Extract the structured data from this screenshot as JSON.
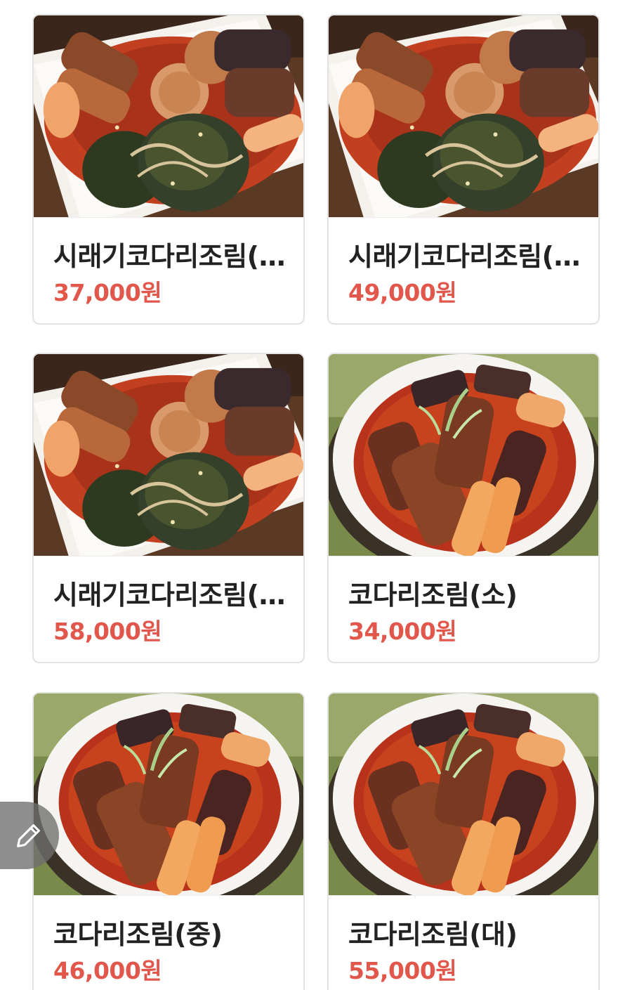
{
  "colors": {
    "price": "#e2574c",
    "name": "#222222",
    "card_border": "#e2e2e2"
  },
  "menu": {
    "items": [
      {
        "name": "시래기코다리조림(...",
        "price": "37,000원",
        "photo": "siraegi-braised-pollack"
      },
      {
        "name": "시래기코다리조림(...",
        "price": "49,000원",
        "photo": "siraegi-braised-pollack"
      },
      {
        "name": "시래기코다리조림(...",
        "price": "58,000원",
        "photo": "siraegi-braised-pollack"
      },
      {
        "name": "코다리조림(소)",
        "price": "34,000원",
        "photo": "braised-pollack-bowl"
      },
      {
        "name": "코다리조림(중)",
        "price": "46,000원",
        "photo": "braised-pollack-bowl"
      },
      {
        "name": "코다리조림(대)",
        "price": "55,000원",
        "photo": "braised-pollack-bowl"
      }
    ]
  },
  "floating_button": {
    "icon": "pencil-icon"
  }
}
